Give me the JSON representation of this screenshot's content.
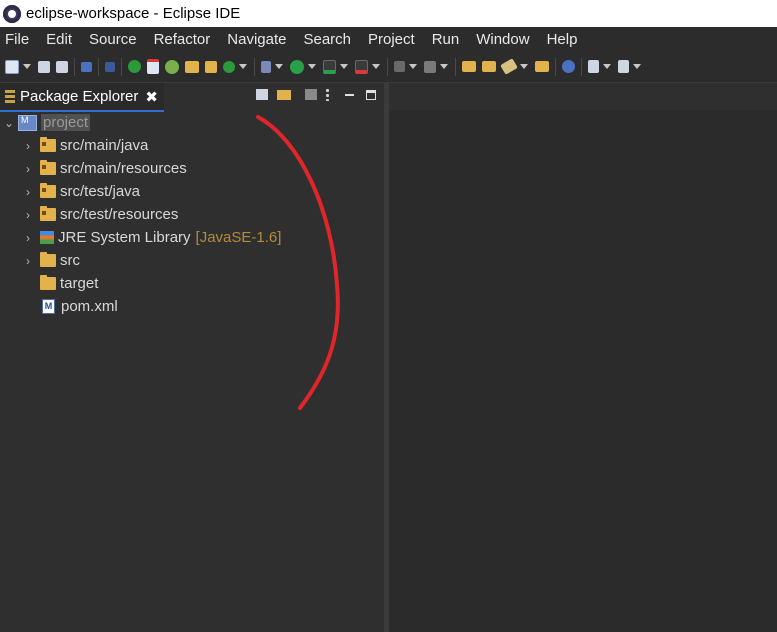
{
  "window": {
    "title": "eclipse-workspace - Eclipse IDE",
    "app_icon": "eclipse-icon"
  },
  "menubar": {
    "items": [
      "File",
      "Edit",
      "Source",
      "Refactor",
      "Navigate",
      "Search",
      "Project",
      "Run",
      "Window",
      "Help"
    ]
  },
  "package_explorer": {
    "tab_label": "Package Explorer",
    "close_glyph": "✖",
    "actions": [
      "collapse-all-icon",
      "link-with-editor-icon",
      "filter-icon",
      "view-menu-icon",
      "minimize-icon",
      "maximize-icon"
    ],
    "tree": {
      "project": {
        "label": "project",
        "expanded": true,
        "chevron": "⌄"
      },
      "children": [
        {
          "label": "src/main/java",
          "icon": "package-folder-icon",
          "chevron": "›"
        },
        {
          "label": "src/main/resources",
          "icon": "package-folder-icon",
          "chevron": "›"
        },
        {
          "label": "src/test/java",
          "icon": "package-folder-icon",
          "chevron": "›"
        },
        {
          "label": "src/test/resources",
          "icon": "package-folder-icon",
          "chevron": "›"
        },
        {
          "label": "JRE System Library",
          "decoration": "[JavaSE-1.6]",
          "icon": "library-icon",
          "chevron": "›"
        },
        {
          "label": "src",
          "icon": "folder-icon",
          "chevron": "›"
        },
        {
          "label": "target",
          "icon": "folder-icon",
          "chevron": ""
        },
        {
          "label": "pom.xml",
          "icon": "xml-file-icon",
          "icon_glyph": "M",
          "chevron": ""
        }
      ]
    }
  },
  "colors": {
    "background": "#2f2f2f",
    "tab_underline": "#2f6fd0",
    "decoration": "#b58b3a",
    "folder": "#e2b34c",
    "annotation": "#e0262a"
  }
}
